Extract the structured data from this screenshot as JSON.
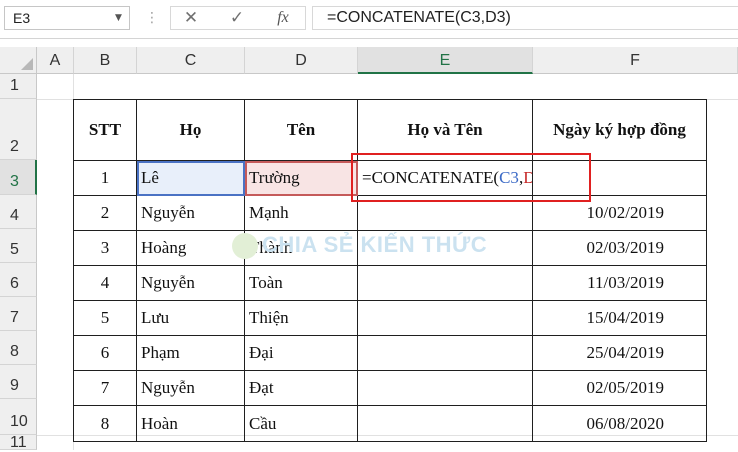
{
  "formula_bar": {
    "name_box": "E3",
    "cancel_icon": "✕",
    "enter_icon": "✓",
    "fx_label": "fx",
    "formula": "=CONCATENATE(C3,D3)"
  },
  "columns": [
    "A",
    "B",
    "C",
    "D",
    "E",
    "F"
  ],
  "rows": [
    "1",
    "2",
    "3",
    "4",
    "5",
    "6",
    "7",
    "8",
    "9",
    "10",
    "11"
  ],
  "selected": {
    "column": "E",
    "row": "3"
  },
  "table": {
    "headers": [
      "STT",
      "Họ",
      "Tên",
      "Họ và Tên",
      "Ngày ký hợp đồng"
    ],
    "rows": [
      {
        "stt": "1",
        "ho": "Lê",
        "ten": "Trường",
        "hovaten": "",
        "ngay": ""
      },
      {
        "stt": "2",
        "ho": "Nguyễn",
        "ten": "Mạnh",
        "hovaten": "",
        "ngay": "10/02/2019"
      },
      {
        "stt": "3",
        "ho": "Hoàng",
        "ten": "Thành",
        "hovaten": "",
        "ngay": "02/03/2019"
      },
      {
        "stt": "4",
        "ho": "Nguyễn",
        "ten": "Toàn",
        "hovaten": "",
        "ngay": "11/03/2019"
      },
      {
        "stt": "5",
        "ho": "Lưu",
        "ten": "Thiện",
        "hovaten": "",
        "ngay": "15/04/2019"
      },
      {
        "stt": "6",
        "ho": "Phạm",
        "ten": "Đại",
        "hovaten": "",
        "ngay": "25/04/2019"
      },
      {
        "stt": "7",
        "ho": "Nguyễn",
        "ten": "Đạt",
        "hovaten": "",
        "ngay": "02/05/2019"
      },
      {
        "stt": "8",
        "ho": "Hoàn",
        "ten": "Cầu",
        "hovaten": "",
        "ngay": "06/08/2020"
      }
    ]
  },
  "editing_cell": {
    "prefix": "=CONCATENATE(",
    "ref1": "C3",
    "sep": ",",
    "ref2": "D3",
    "suffix": ")"
  },
  "watermark": "CHIA SẺ KIẾN THỨC",
  "colors": {
    "ref_blue": "#3a69c6",
    "ref_red": "#c62828",
    "excel_green": "#217346",
    "highlight_box": "#e02020"
  }
}
